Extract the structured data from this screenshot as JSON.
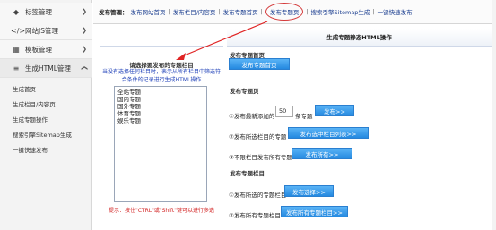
{
  "sidebar": {
    "items": [
      {
        "icon": "tag-icon",
        "glyph": "◆",
        "label": "标签管理"
      },
      {
        "icon": "code-icon",
        "glyph": "</>",
        "label": "网站JS管理"
      },
      {
        "icon": "template-icon",
        "glyph": "▦",
        "label": "模板管理"
      },
      {
        "icon": "list-icon",
        "glyph": "≡",
        "label": "生成HTML管理"
      }
    ],
    "sub_items": [
      "生成首页",
      "生成栏目/内容页",
      "生成专题操作",
      "搜索引擎Sitemap生成",
      "一键快速发布"
    ]
  },
  "topbar": {
    "label": "发布管理：",
    "tabs": [
      "发布网站首页",
      "发布栏目/内容页",
      "发布专题首页",
      "发布专题页",
      "搜索引擎Sitemap生成",
      "一键快速发布"
    ]
  },
  "left": {
    "pick_title": "请选择要发布的专题栏目",
    "hint_line1": "当没有选择任何栏目时，表示从所有栏目中筛选符",
    "hint_line2": "合条件的记录进行生成HTML操作",
    "topics": [
      "全站专题",
      "国内专题",
      "国外专题",
      "体育专题",
      "娱乐专题"
    ],
    "tip": "提示：按住\"CTRL\"或\"Shift\"键可以进行多选"
  },
  "right": {
    "header": "生成专题静态HTML操作",
    "sec_home": "发布专题首页",
    "btn_home": "发布专题首页",
    "sec_page": "发布专题页",
    "row1_pre": "①发布最新添加的",
    "row1_value": "50",
    "row1_post": "条专题",
    "row1_btn": "发布>>",
    "row2_pre": "②发布所选栏目的专题",
    "row2_btn": "发布选中栏目列表>>",
    "row3_pre": "③不限栏目发布所有专题",
    "row3_btn": "发布所有>>",
    "sec_cat": "发布专题栏目",
    "row4_pre": "①发布所选的专题栏目",
    "row4_btn": "发布选择>>",
    "row5_pre": "②发布所有专题栏目",
    "row5_btn": "发布所有专题栏目>>"
  }
}
